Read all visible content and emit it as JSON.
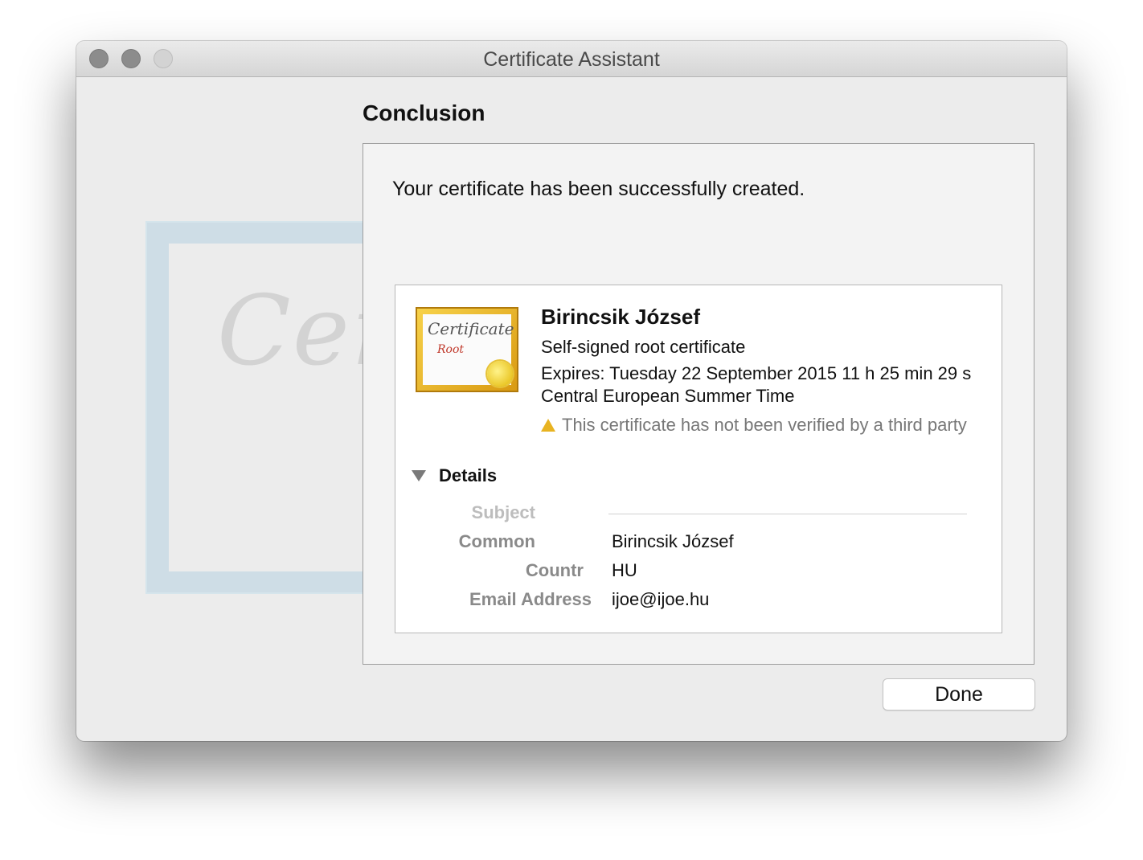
{
  "window": {
    "title": "Certificate Assistant"
  },
  "background_art": {
    "script_text": "Certif"
  },
  "page": {
    "heading": "Conclusion",
    "success_message": "Your certificate has been successfully created."
  },
  "certificate": {
    "icon_title": "Certificate",
    "icon_subtitle": "Root",
    "name": "Birincsik József",
    "type": "Self-signed root certificate",
    "expires": "Expires: Tuesday 22 September 2015 11 h 25 min 29 s Central European Summer Time",
    "warning": "This certificate has not been verified by a third party"
  },
  "details": {
    "label": "Details",
    "section": "Subject",
    "rows": [
      {
        "label": "Common",
        "value": "Birincsik József"
      },
      {
        "label": "Countr",
        "value": "HU"
      },
      {
        "label": "Email Address",
        "value": "ijoe@ijoe.hu"
      }
    ]
  },
  "buttons": {
    "done": "Done"
  },
  "colors": {
    "warning": "#e8b321",
    "certificate_gold": "#d99a12"
  }
}
